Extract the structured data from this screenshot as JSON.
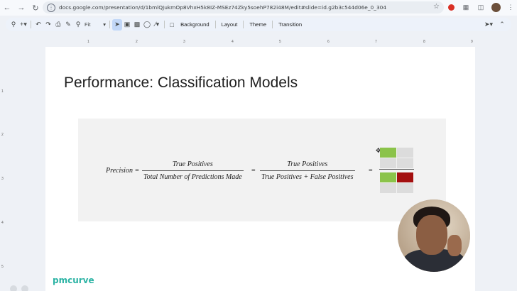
{
  "browser": {
    "url": "docs.google.com/presentation/d/1bmlQJukmOp8VhxH5k8IZ-MSEz74Zky5soehP782i48M/edit#slide=id.g2b3c544d06e_0_304"
  },
  "toolbar": {
    "zoom": "Fit",
    "background_label": "Background",
    "layout_label": "Layout",
    "theme_label": "Theme",
    "transition_label": "Transition"
  },
  "ruler": {
    "top_numbers": [
      "1",
      "2",
      "3",
      "4",
      "5",
      "6",
      "7",
      "8",
      "9"
    ],
    "left_numbers": [
      "1",
      "2",
      "3",
      "4",
      "5"
    ]
  },
  "slide": {
    "title": "Performance: Classification Models",
    "formula": {
      "lhs": "Precision =",
      "frac1_num": "True Positives",
      "frac1_den": "Total Number of Predictions Made",
      "eq1": "=",
      "frac2_num": "True Positives",
      "frac2_den": "True Positives + False Positives",
      "eq2": "="
    },
    "matrix_colors": {
      "green": "#8bc34a",
      "red": "#a30f0f",
      "gray": "#dcdcdc"
    },
    "brand": "pmcurve"
  }
}
